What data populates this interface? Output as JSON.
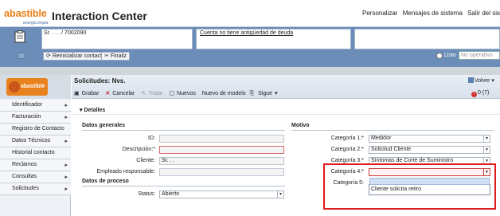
{
  "header": {
    "logo_text": "abastible",
    "logo_sub": "energía limpia",
    "title": "Interaction Center",
    "links": [
      "Personalizar",
      "Mensajes de sistema",
      "Salir del sis"
    ]
  },
  "context": {
    "customer": "Sr. . . . / 7002090",
    "debt_link": "Cuenta no tiene antigüedad de deuda",
    "reset_button": "Reinicializar contacto",
    "finalize_button": "Finaliz",
    "status_label": "Listo",
    "status_value": "No operativo"
  },
  "nav": {
    "logo_text": "abastible",
    "items": [
      {
        "label": "Identificador"
      },
      {
        "label": "Facturación"
      },
      {
        "label": "Registro de Contacto"
      },
      {
        "label": "Datos Técnicos"
      },
      {
        "label": "Historial contacto"
      },
      {
        "label": "Reclamos"
      },
      {
        "label": "Consultas"
      },
      {
        "label": "Solicitudes"
      }
    ]
  },
  "main": {
    "title": "Solicitudes: Nvs.",
    "back_button": "Volver",
    "toolbar": {
      "save": "Grabar",
      "cancel": "Cancelar",
      "treat": "Tratar",
      "new": "Nuevos",
      "new_model": "Nuevo de modelo",
      "next": "Sigue"
    },
    "alerts": "0 (7)",
    "section": "Detalles"
  },
  "general": {
    "title": "Datos generales",
    "fields": [
      {
        "label": "ID:",
        "value": ""
      },
      {
        "label": "Descripción:*",
        "value": ""
      },
      {
        "label": "Cliente:",
        "value": "Sr. . ."
      },
      {
        "label": "Empleado responsable:",
        "value": ""
      }
    ]
  },
  "process": {
    "title": "Datos de proceso",
    "status_label": "Status:",
    "status_value": "Abierto"
  },
  "motivo": {
    "title": "Motivo",
    "categories": [
      {
        "label": "Categoría 1:*",
        "value": "Medidor"
      },
      {
        "label": "Categoría 2:*",
        "value": "Solicitud Cliente"
      },
      {
        "label": "Categoría 3:*",
        "value": "Síntomas de Corte de Suministro"
      },
      {
        "label": "Categoría 4:*",
        "value": ""
      },
      {
        "label": "Categoría 5:",
        "value": ""
      }
    ],
    "dropdown_options": [
      "Cliente solicita retiro"
    ]
  }
}
